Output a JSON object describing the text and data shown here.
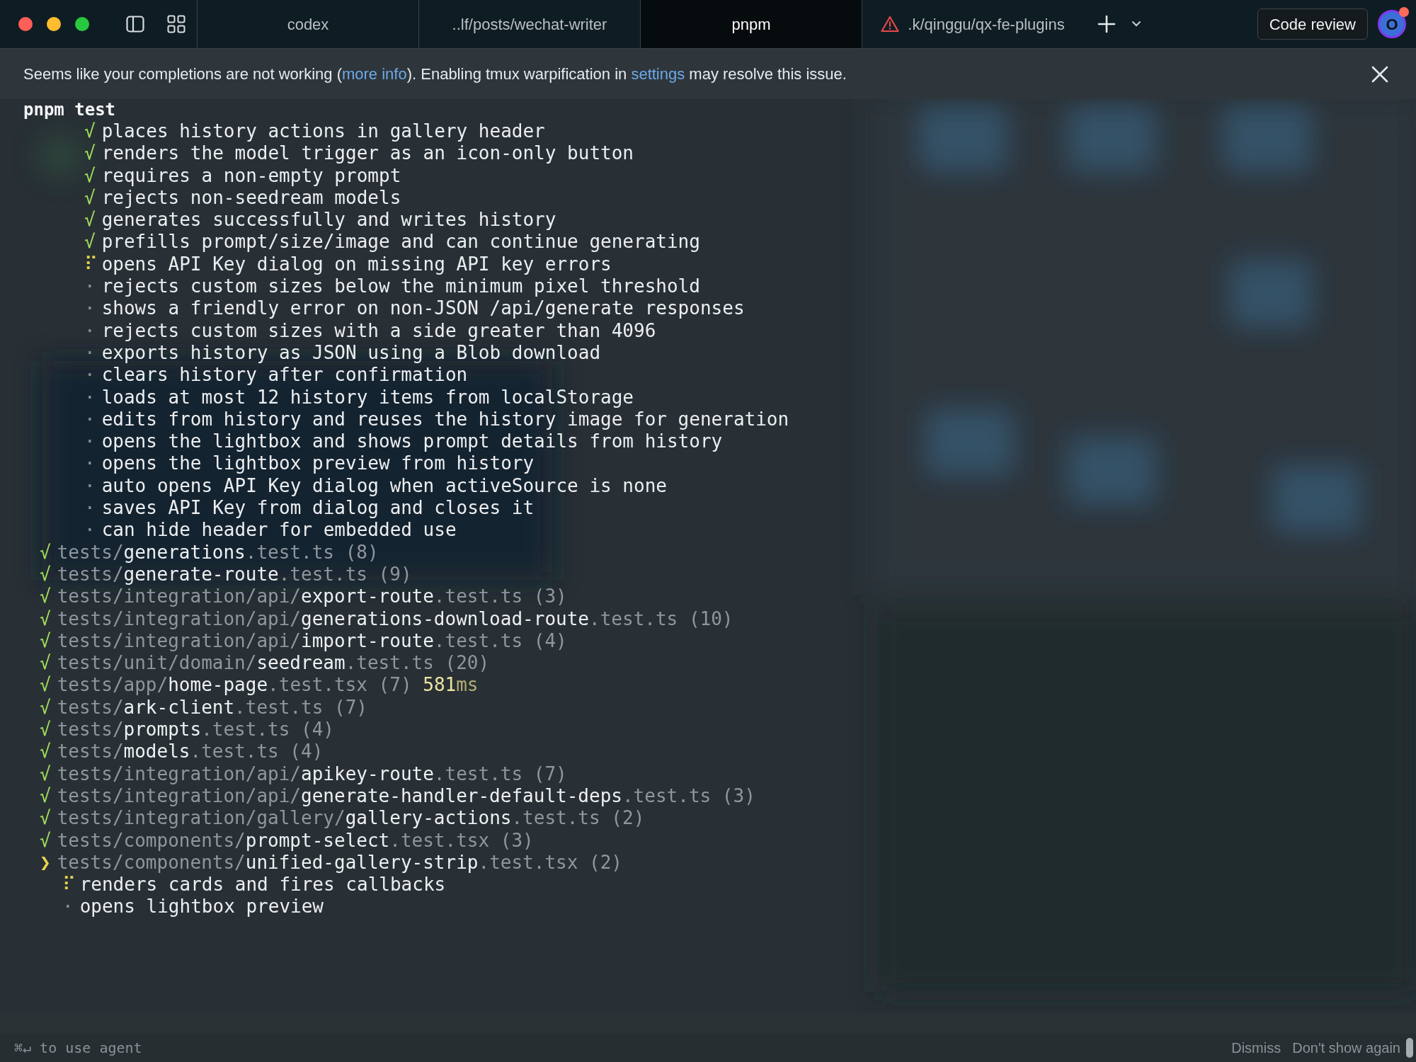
{
  "tabs": [
    {
      "label": "codex",
      "selected": false,
      "warning": false
    },
    {
      "label": "..lf/posts/wechat-writer",
      "selected": false,
      "warning": false
    },
    {
      "label": "pnpm",
      "selected": true,
      "warning": false
    },
    {
      "label": ".k/qinggu/qx-fe-plugins",
      "selected": false,
      "warning": true
    }
  ],
  "code_review_button": "Code review",
  "avatar": {
    "initial": "O",
    "notification": true
  },
  "banner": {
    "parts": [
      {
        "kind": "text",
        "text": "Seems like your completions are not working ("
      },
      {
        "kind": "link",
        "text": "more info"
      },
      {
        "kind": "text",
        "text": "). Enabling tmux warpification in "
      },
      {
        "kind": "link",
        "text": "settings"
      },
      {
        "kind": "text",
        "text": " may resolve this issue."
      }
    ]
  },
  "command": "pnpm test",
  "output": [
    {
      "kind": "case",
      "passed": true,
      "running": false,
      "marker": "√",
      "text": "places history actions in gallery header"
    },
    {
      "kind": "case",
      "passed": true,
      "running": false,
      "marker": "√",
      "text": "renders the model trigger as an icon-only button"
    },
    {
      "kind": "case",
      "passed": true,
      "running": false,
      "marker": "√",
      "text": "requires a non-empty prompt"
    },
    {
      "kind": "case",
      "passed": true,
      "running": false,
      "marker": "√",
      "text": "rejects non-seedream models"
    },
    {
      "kind": "case",
      "passed": true,
      "running": false,
      "marker": "√",
      "text": "generates successfully and writes history"
    },
    {
      "kind": "case",
      "passed": true,
      "running": false,
      "marker": "√",
      "text": "prefills prompt/size/image and can continue generating"
    },
    {
      "kind": "case",
      "passed": false,
      "running": true,
      "marker": "⠏",
      "text": "opens API Key dialog on missing API key errors"
    },
    {
      "kind": "case",
      "passed": false,
      "running": false,
      "marker": "·",
      "text": "rejects custom sizes below the minimum pixel threshold"
    },
    {
      "kind": "case",
      "passed": false,
      "running": false,
      "marker": "·",
      "text": "shows a friendly error on non-JSON /api/generate responses"
    },
    {
      "kind": "case",
      "passed": false,
      "running": false,
      "marker": "·",
      "text": "rejects custom sizes with a side greater than 4096"
    },
    {
      "kind": "case",
      "passed": false,
      "running": false,
      "marker": "·",
      "text": "exports history as JSON using a Blob download"
    },
    {
      "kind": "case",
      "passed": false,
      "running": false,
      "marker": "·",
      "text": "clears history after confirmation"
    },
    {
      "kind": "case",
      "passed": false,
      "running": false,
      "marker": "·",
      "text": "loads at most 12 history items from localStorage"
    },
    {
      "kind": "case",
      "passed": false,
      "running": false,
      "marker": "·",
      "text": "edits from history and reuses the history image for generation"
    },
    {
      "kind": "case",
      "passed": false,
      "running": false,
      "marker": "·",
      "text": "opens the lightbox and shows prompt details from history"
    },
    {
      "kind": "case",
      "passed": false,
      "running": false,
      "marker": "·",
      "text": "opens the lightbox preview from history"
    },
    {
      "kind": "case",
      "passed": false,
      "running": false,
      "marker": "·",
      "text": "auto opens API Key dialog when activeSource is none"
    },
    {
      "kind": "case",
      "passed": false,
      "running": false,
      "marker": "·",
      "text": "saves API Key from dialog and closes it"
    },
    {
      "kind": "case",
      "passed": false,
      "running": false,
      "marker": "·",
      "text": "can hide header for embedded use"
    },
    {
      "kind": "file",
      "passed": true,
      "running": false,
      "marker": "√",
      "dir": "tests/",
      "name": "generations",
      "ext": ".test.ts",
      "count": "(8)"
    },
    {
      "kind": "file",
      "passed": true,
      "running": false,
      "marker": "√",
      "dir": "tests/",
      "name": "generate-route",
      "ext": ".test.ts",
      "count": "(9)"
    },
    {
      "kind": "file",
      "passed": true,
      "running": false,
      "marker": "√",
      "dir": "tests/integration/api/",
      "name": "export-route",
      "ext": ".test.ts",
      "count": "(3)"
    },
    {
      "kind": "file",
      "passed": true,
      "running": false,
      "marker": "√",
      "dir": "tests/integration/api/",
      "name": "generations-download-route",
      "ext": ".test.ts",
      "count": "(10)"
    },
    {
      "kind": "file",
      "passed": true,
      "running": false,
      "marker": "√",
      "dir": "tests/integration/api/",
      "name": "import-route",
      "ext": ".test.ts",
      "count": "(4)"
    },
    {
      "kind": "file",
      "passed": true,
      "running": false,
      "marker": "√",
      "dir": "tests/unit/domain/",
      "name": "seedream",
      "ext": ".test.ts",
      "count": "(20)"
    },
    {
      "kind": "file",
      "passed": true,
      "running": false,
      "marker": "√",
      "dir": "tests/app/",
      "name": "home-page",
      "ext": ".test.tsx",
      "count": "(7)",
      "duration": "581",
      "unit": "ms"
    },
    {
      "kind": "file",
      "passed": true,
      "running": false,
      "marker": "√",
      "dir": "tests/",
      "name": "ark-client",
      "ext": ".test.ts",
      "count": "(7)"
    },
    {
      "kind": "file",
      "passed": true,
      "running": false,
      "marker": "√",
      "dir": "tests/",
      "name": "prompts",
      "ext": ".test.ts",
      "count": "(4)"
    },
    {
      "kind": "file",
      "passed": true,
      "running": false,
      "marker": "√",
      "dir": "tests/",
      "name": "models",
      "ext": ".test.ts",
      "count": "(4)"
    },
    {
      "kind": "file",
      "passed": true,
      "running": false,
      "marker": "√",
      "dir": "tests/integration/api/",
      "name": "apikey-route",
      "ext": ".test.ts",
      "count": "(7)"
    },
    {
      "kind": "file",
      "passed": true,
      "running": false,
      "marker": "√",
      "dir": "tests/integration/api/",
      "name": "generate-handler-default-deps",
      "ext": ".test.ts",
      "count": "(3)"
    },
    {
      "kind": "file",
      "passed": true,
      "running": false,
      "marker": "√",
      "dir": "tests/integration/gallery/",
      "name": "gallery-actions",
      "ext": ".test.ts",
      "count": "(2)"
    },
    {
      "kind": "file",
      "passed": true,
      "running": false,
      "marker": "√",
      "dir": "tests/components/",
      "name": "prompt-select",
      "ext": ".test.tsx",
      "count": "(3)"
    },
    {
      "kind": "file",
      "passed": false,
      "running": true,
      "marker": "❯",
      "dir": "tests/components/",
      "name": "unified-gallery-strip",
      "ext": ".test.tsx",
      "count": "(2)",
      "children": [
        {
          "kind": "case",
          "passed": false,
          "running": true,
          "marker": "⠏",
          "text": "renders cards and fires callbacks"
        },
        {
          "kind": "case",
          "passed": false,
          "running": false,
          "marker": "·",
          "text": "opens lightbox preview"
        }
      ]
    }
  ],
  "footer": {
    "hint": "⌘↵ to use agent",
    "actions": [
      "Dismiss",
      "Don't show again"
    ]
  }
}
